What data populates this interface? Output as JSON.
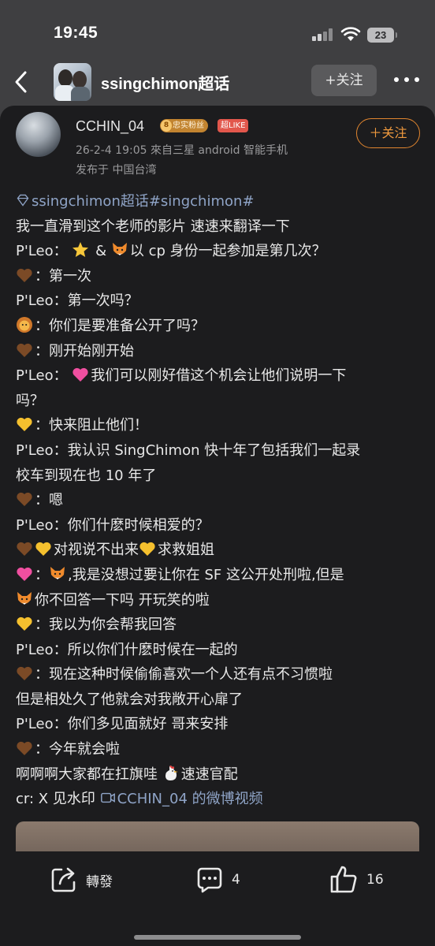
{
  "status_bar": {
    "time": "19:45",
    "battery": "23"
  },
  "nav": {
    "title": "ssingchimon超话",
    "follow_label": "+关注"
  },
  "post": {
    "author": "CCHIN_04",
    "badge_fan_level": "8",
    "badge_fan": "忠实粉丝",
    "badge_like": "超LIKE",
    "meta": "26-2-4 19:05  來自三星 android 智能手机",
    "location": "发布于 中国台湾",
    "follow_label": "关注",
    "topic": "ssingchimon超话#singchimon#",
    "lines": {
      "l1": "我一直滑到这个老师的影片 速速来翻译一下",
      "l2a": "P'Leo：",
      "l2b": "&",
      "l2c": "以 cp 身份一起参加是第几次？",
      "l3": "：第一次",
      "l4": "P'Leo：第一次吗？",
      "l5": "：你们是要准备公开了吗？",
      "l6": "：刚开始刚开始",
      "l7a": "P'Leo：",
      "l7b": "我们可以刚好借这个机会让他们说明一下",
      "l8": "吗？",
      "l9": "：快来阻止他们！",
      "l10": "P'Leo：我认识 SingChimon 快十年了包括我们一起录",
      "l11": "校车到现在也 10 年了",
      "l12": "：嗯",
      "l13": "P'Leo：你们什麽时候相爱的？",
      "l14a": "对视说不出来",
      "l14b": "求救姐姐",
      "l15a": "：",
      "l15b": ",我是没想过要让你在 SF 这公开处刑啦,但是",
      "l16": "你不回答一下吗 开玩笑的啦",
      "l17": "：我以为你会帮我回答",
      "l18": "P'Leo：所以你们什麽时候在一起的",
      "l19": "：现在这种时候偷偷喜欢一个人还有点不习惯啦",
      "l20": "但是相处久了他就会对我敞开心扉了",
      "l21": "P'Leo：你们多见面就好 哥来安排",
      "l22": "：今年就会啦",
      "l23a": "啊啊啊大家都在扛旗哇",
      "l23b": "速速官配",
      "l24a": "cr: X 见水印",
      "l24b": "CCHIN_04 的微博视频"
    }
  },
  "actions": {
    "repost_label": "轉發",
    "comment_count": "4",
    "like_count": "16"
  }
}
